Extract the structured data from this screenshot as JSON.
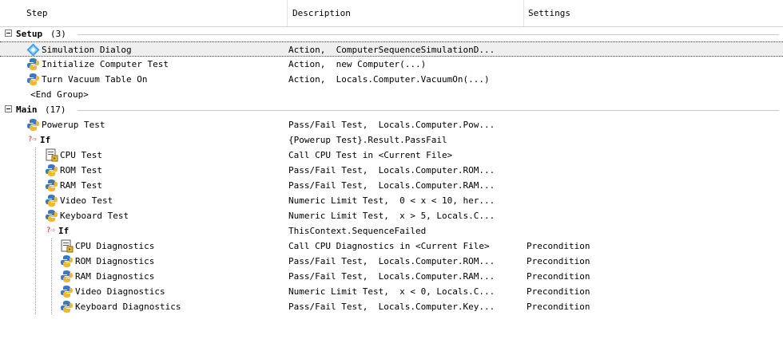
{
  "columns": {
    "step": "Step",
    "description": "Description",
    "settings": "Settings"
  },
  "rows": [
    {
      "kind": "group",
      "label": "Setup",
      "count": "(3)"
    },
    {
      "kind": "step",
      "icon": "sequence-icon",
      "step": "Simulation Dialog",
      "description": "Action,  ComputerSequenceSimulationD...",
      "settings": "",
      "selected": true
    },
    {
      "kind": "step",
      "icon": "python-icon",
      "step": "Initialize Computer Test",
      "description": "Action,  new Computer(...)",
      "settings": ""
    },
    {
      "kind": "step",
      "icon": "python-icon",
      "step": "Turn Vacuum Table On",
      "description": "Action,  Locals.Computer.VacuumOn(...)",
      "settings": ""
    },
    {
      "kind": "end",
      "step": "<End Group>"
    },
    {
      "kind": "group",
      "label": "Main",
      "count": "(17)"
    },
    {
      "kind": "step",
      "icon": "python-icon",
      "step": "Powerup Test",
      "description": "Pass/Fail Test,  Locals.Computer.Pow...",
      "settings": ""
    },
    {
      "kind": "if",
      "marker": "?⇨",
      "step": "If",
      "description": "{Powerup Test}.Result.PassFail",
      "settings": ""
    },
    {
      "kind": "step",
      "icon": "sequence-call-icon",
      "step": "CPU Test",
      "description": "Call CPU Test in <Current File>",
      "settings": ""
    },
    {
      "kind": "step",
      "icon": "python-icon",
      "step": "ROM Test",
      "description": "Pass/Fail Test,  Locals.Computer.ROM...",
      "settings": ""
    },
    {
      "kind": "step",
      "icon": "python-icon",
      "step": "RAM Test",
      "description": "Pass/Fail Test,  Locals.Computer.RAM...",
      "settings": ""
    },
    {
      "kind": "step",
      "icon": "python-icon",
      "step": "Video Test",
      "description": "Numeric Limit Test,  0 < x < 10, her...",
      "settings": ""
    },
    {
      "kind": "step",
      "icon": "python-icon",
      "step": "Keyboard Test",
      "description": "Numeric Limit Test,  x > 5, Locals.C...",
      "settings": ""
    },
    {
      "kind": "if",
      "marker": "?⇨",
      "step": "If",
      "description": "ThisContext.SequenceFailed",
      "settings": ""
    },
    {
      "kind": "step",
      "icon": "sequence-call-icon",
      "step": "CPU Diagnostics",
      "description": "Call CPU Diagnostics in <Current File>",
      "settings": "Precondition"
    },
    {
      "kind": "step",
      "icon": "python-icon",
      "step": "ROM Diagnostics",
      "description": "Pass/Fail Test,  Locals.Computer.ROM...",
      "settings": "Precondition"
    },
    {
      "kind": "step",
      "icon": "python-icon",
      "step": "RAM Diagnostics",
      "description": "Pass/Fail Test,  Locals.Computer.RAM...",
      "settings": "Precondition"
    },
    {
      "kind": "step",
      "icon": "python-icon",
      "step": "Video Diagnostics",
      "description": "Numeric Limit Test,  x < 0, Locals.C...",
      "settings": "Precondition"
    },
    {
      "kind": "step",
      "icon": "python-icon",
      "step": "Keyboard Diagnostics",
      "description": "Pass/Fail Test,  Locals.Computer.Key...",
      "settings": "Precondition"
    }
  ]
}
